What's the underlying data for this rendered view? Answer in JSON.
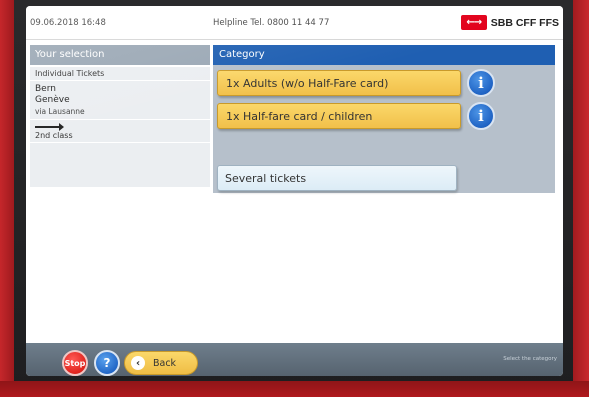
{
  "header": {
    "datetime": "09.06.2018 16:48",
    "helpline": "Helpline  Tel. 0800 11 44 77",
    "logo_text": "SBB CFF FFS",
    "logo_icon": "sbb-swiss-cross-arrows-icon"
  },
  "selection": {
    "title": "Your selection",
    "ticket_type": "Individual Tickets",
    "from": "Bern",
    "to": "Genève",
    "via": "via Lausanne",
    "direction_icon": "single-arrow-icon",
    "class": "2nd class"
  },
  "category": {
    "title": "Category",
    "options": [
      {
        "label": "1x Adults (w/o Half-Fare card)",
        "info": "i"
      },
      {
        "label": "1x Half-fare card / children",
        "info": "i"
      }
    ],
    "several_label": "Several tickets"
  },
  "footer": {
    "stop_label": "Stop",
    "help_label": "?",
    "back_label": "Back",
    "back_icon": "chevron-left-icon",
    "status": "Select the category"
  },
  "colors": {
    "category_blue": "#1f5fb2",
    "option_yellow": "#f1c04a",
    "selection_grey": "#9ba8b5",
    "machine_red": "#b31d22"
  }
}
